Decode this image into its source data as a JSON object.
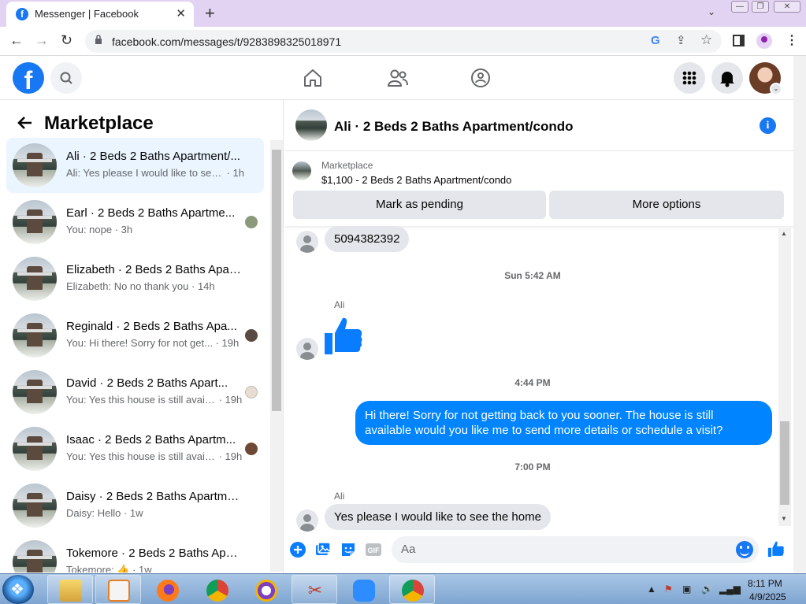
{
  "browser": {
    "tab_title": "Messenger | Facebook",
    "url": "facebook.com/messages/t/9283898325018971"
  },
  "sidebar": {
    "title": "Marketplace",
    "conversations": [
      {
        "name": "Ali · 2 Beds 2 Baths Apartment/...",
        "preview": "Ali: Yes please I would like to see t...",
        "time": " · 1h"
      },
      {
        "name": "Earl · 2 Beds 2 Baths Apartme...",
        "preview": "You: nope",
        "time": " · 3h"
      },
      {
        "name": "Elizabeth · 2 Beds 2 Baths Apart...",
        "preview": "Elizabeth: No no thank you",
        "time": " · 14h"
      },
      {
        "name": "Reginald · 2 Beds 2 Baths Apa...",
        "preview": "You: Hi there! Sorry for not get...",
        "time": " · 19h"
      },
      {
        "name": "David · 2 Beds 2 Baths Apart...",
        "preview": "You: Yes this house is still availa...",
        "time": " · 19h"
      },
      {
        "name": "Isaac · 2 Beds 2 Baths Apartm...",
        "preview": "You: Yes this house is still availa...",
        "time": " · 19h"
      },
      {
        "name": "Daisy · 2 Beds 2 Baths Apartme...",
        "preview": "Daisy: Hello",
        "time": " · 1w"
      },
      {
        "name": "Tokemore · 2 Beds 2 Baths Apar...",
        "preview": "Tokemore: 👍",
        "time": " · 1w"
      }
    ]
  },
  "chat": {
    "title": "Ali · 2 Beds 2 Baths Apartment/condo",
    "listing_label": "Marketplace",
    "listing_price": "$1,100 - 2 Beds 2 Baths Apartment/condo",
    "mark_pending": "Mark as pending",
    "more_options": "More options",
    "messages": {
      "phone": "5094382392",
      "ts1": "Sun 5:42 AM",
      "sender1": "Ali",
      "ts2": "4:44 PM",
      "outgoing": "Hi there! Sorry for not getting back to you sooner. The house is still available would you like me to send more details or schedule a visit?",
      "ts3": "7:00 PM",
      "sender2": "Ali",
      "last_in": "Yes please I would like to see the home"
    },
    "composer_placeholder": "Aa"
  },
  "taskbar": {
    "time": "8:11 PM",
    "date": "4/9/2025"
  },
  "colors": {
    "brand": "#1877f2",
    "outgoing_bubble": "#0084ff",
    "active_row": "#ebf5ff"
  }
}
